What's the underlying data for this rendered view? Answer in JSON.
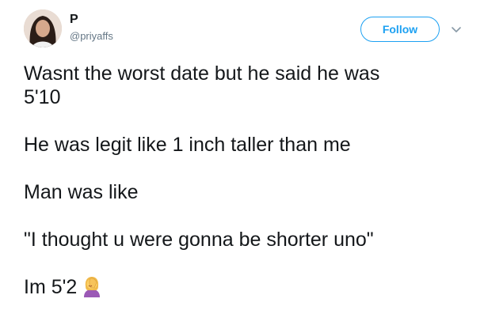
{
  "tweet": {
    "author": {
      "name": "P",
      "handle": "@priyaffs"
    },
    "follow_label": "Follow",
    "lines": [
      "Wasnt the worst date but he said he was",
      "5'10",
      "He was legit like 1 inch taller than me",
      "Man was like",
      "\"I thought u were gonna be shorter uno\"",
      "Im 5'2"
    ],
    "emoji": "woman-facepalming-emoji"
  },
  "colors": {
    "accent": "#1da1f2",
    "text": "#14171a",
    "secondary_text": "#657786"
  },
  "icons": {
    "menu": "chevron-down-icon",
    "avatar": "user-avatar"
  }
}
